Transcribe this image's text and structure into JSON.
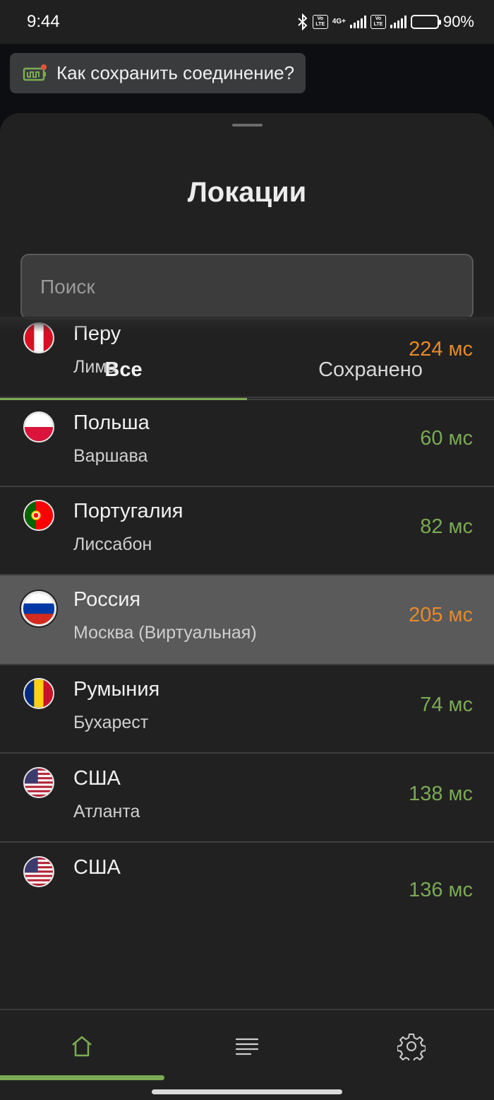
{
  "status_bar": {
    "time": "9:44",
    "battery": "90%",
    "network": "4G+",
    "volte": "Vo LTE",
    "battery_level": 0.9
  },
  "tip": {
    "label": "Как сохранить соединение?"
  },
  "sheet": {
    "title": "Локации",
    "search": {
      "placeholder": "Поиск",
      "value": ""
    },
    "tabs": [
      {
        "label": "Все",
        "active": true
      },
      {
        "label": "Сохранено",
        "active": false
      }
    ]
  },
  "locations": [
    {
      "country": "Перу",
      "city": "Лима",
      "ping": "224 мс",
      "ping_status": "orange",
      "flag": "peru-flag"
    },
    {
      "country": "Польша",
      "city": "Варшава",
      "ping": "60 мс",
      "ping_status": "green",
      "flag": "poland-flag"
    },
    {
      "country": "Португалия",
      "city": "Лиссабон",
      "ping": "82 мс",
      "ping_status": "green",
      "flag": "portugal-flag"
    },
    {
      "country": "Россия",
      "city": "Москва (Виртуальная)",
      "ping": "205 мс",
      "ping_status": "orange",
      "flag": "russia-flag",
      "selected": true
    },
    {
      "country": "Румыния",
      "city": "Бухарест",
      "ping": "74 мс",
      "ping_status": "green",
      "flag": "romania-flag"
    },
    {
      "country": "США",
      "city": "Атланта",
      "ping": "138 мс",
      "ping_status": "green",
      "flag": "usa-flag"
    },
    {
      "country": "США",
      "city": "",
      "ping": "136 мс",
      "ping_status": "green",
      "flag": "usa-flag"
    }
  ],
  "bottom_nav": [
    {
      "name": "home",
      "icon": "home-icon",
      "active": true
    },
    {
      "name": "list",
      "icon": "list-icon",
      "active": false
    },
    {
      "name": "settings",
      "icon": "gear-icon",
      "active": false
    }
  ],
  "colors": {
    "accent": "#7dab54",
    "ping_green": "#7aa955",
    "ping_orange": "#e58a2a",
    "sheet_bg": "#212121",
    "selected_row": "#5a5a5a"
  }
}
